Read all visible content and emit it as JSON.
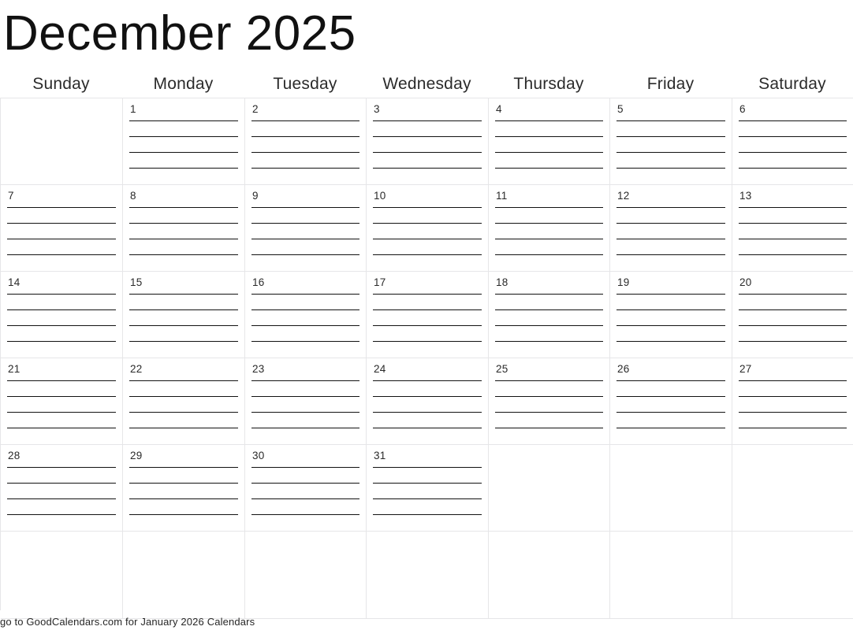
{
  "title": "December 2025",
  "month": "December",
  "year": "2025",
  "weekdays": [
    "Sunday",
    "Monday",
    "Tuesday",
    "Wednesday",
    "Thursday",
    "Friday",
    "Saturday"
  ],
  "lines_per_day": 4,
  "colors": {
    "grid_border": "#e6e6e8",
    "writing_line": "#121212",
    "text": "#1a1a1a",
    "background": "#ffffff"
  },
  "weeks": [
    {
      "days": [
        {
          "date": "",
          "has_lines": false
        },
        {
          "date": "1",
          "has_lines": true
        },
        {
          "date": "2",
          "has_lines": true
        },
        {
          "date": "3",
          "has_lines": true
        },
        {
          "date": "4",
          "has_lines": true
        },
        {
          "date": "5",
          "has_lines": true
        },
        {
          "date": "6",
          "has_lines": true
        }
      ]
    },
    {
      "days": [
        {
          "date": "7",
          "has_lines": true
        },
        {
          "date": "8",
          "has_lines": true
        },
        {
          "date": "9",
          "has_lines": true
        },
        {
          "date": "10",
          "has_lines": true
        },
        {
          "date": "11",
          "has_lines": true
        },
        {
          "date": "12",
          "has_lines": true
        },
        {
          "date": "13",
          "has_lines": true
        }
      ]
    },
    {
      "days": [
        {
          "date": "14",
          "has_lines": true
        },
        {
          "date": "15",
          "has_lines": true
        },
        {
          "date": "16",
          "has_lines": true
        },
        {
          "date": "17",
          "has_lines": true
        },
        {
          "date": "18",
          "has_lines": true
        },
        {
          "date": "19",
          "has_lines": true
        },
        {
          "date": "20",
          "has_lines": true
        }
      ]
    },
    {
      "days": [
        {
          "date": "21",
          "has_lines": true
        },
        {
          "date": "22",
          "has_lines": true
        },
        {
          "date": "23",
          "has_lines": true
        },
        {
          "date": "24",
          "has_lines": true
        },
        {
          "date": "25",
          "has_lines": true
        },
        {
          "date": "26",
          "has_lines": true
        },
        {
          "date": "27",
          "has_lines": true
        }
      ]
    },
    {
      "days": [
        {
          "date": "28",
          "has_lines": true
        },
        {
          "date": "29",
          "has_lines": true
        },
        {
          "date": "30",
          "has_lines": true
        },
        {
          "date": "31",
          "has_lines": true
        },
        {
          "date": "",
          "has_lines": false
        },
        {
          "date": "",
          "has_lines": false
        },
        {
          "date": "",
          "has_lines": false
        }
      ]
    },
    {
      "days": [
        {
          "date": "",
          "has_lines": false
        },
        {
          "date": "",
          "has_lines": false
        },
        {
          "date": "",
          "has_lines": false
        },
        {
          "date": "",
          "has_lines": false
        },
        {
          "date": "",
          "has_lines": false
        },
        {
          "date": "",
          "has_lines": false
        },
        {
          "date": "",
          "has_lines": false
        }
      ]
    }
  ],
  "footer": {
    "note": "go to GoodCalendars.com for January 2026 Calendars"
  }
}
